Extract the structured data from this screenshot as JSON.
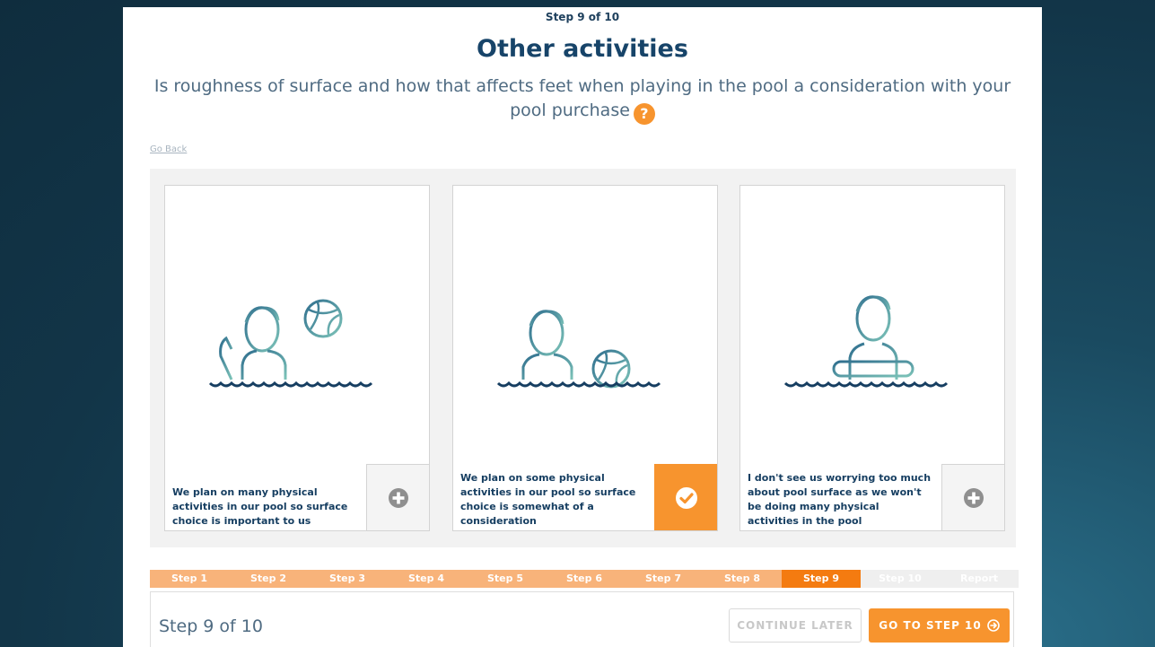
{
  "header": {
    "step_indicator": "Step 9 of 10",
    "title": "Other activities",
    "question": "Is roughness of surface and how that affects feet when playing in the pool a consideration with your pool purchase",
    "help_icon_glyph": "?",
    "go_back_label": "Go Back"
  },
  "options": [
    {
      "text": "We plan on many physical activities in our pool so surface choice is important to us",
      "selected": false,
      "icon": "plus-circle-icon"
    },
    {
      "text": "We plan on some physical activities in our pool so surface choice is somewhat of a consideration",
      "selected": true,
      "icon": "check-circle-icon"
    },
    {
      "text": "I don't see us worrying too much about pool surface as we won't be doing many physical activities in the pool",
      "selected": false,
      "icon": "plus-circle-icon"
    }
  ],
  "progress": {
    "steps": [
      "Step 1",
      "Step 2",
      "Step 3",
      "Step 4",
      "Step 5",
      "Step 6",
      "Step 7",
      "Step 8",
      "Step 9",
      "Step 10",
      "Report"
    ],
    "current": "Step 9"
  },
  "footer": {
    "step_label": "Step 9 of 10",
    "continue_later_label": "CONTINUE LATER",
    "next_label": "GO TO STEP 10"
  },
  "colors": {
    "accent": "#f7942e",
    "accent_dark": "#f47b10",
    "heading": "#174469",
    "illustration_teal": "#4f8fa0",
    "water": "#163e61"
  }
}
